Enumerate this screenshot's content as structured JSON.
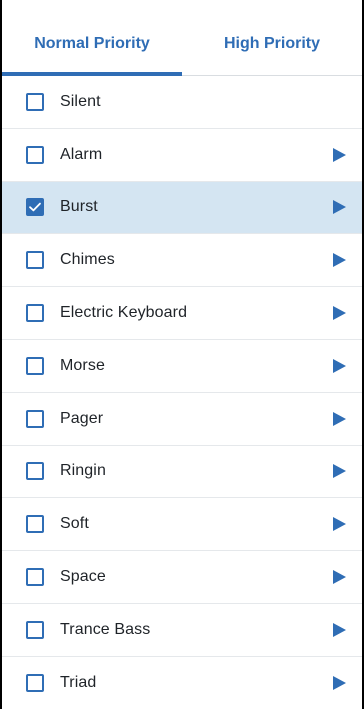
{
  "tabs": [
    {
      "label": "Normal Priority",
      "active": true
    },
    {
      "label": "High Priority",
      "active": false
    }
  ],
  "ringtones": [
    {
      "label": "Silent",
      "checked": false,
      "playable": false
    },
    {
      "label": "Alarm",
      "checked": false,
      "playable": true
    },
    {
      "label": "Burst",
      "checked": true,
      "playable": true
    },
    {
      "label": "Chimes",
      "checked": false,
      "playable": true
    },
    {
      "label": "Electric Keyboard",
      "checked": false,
      "playable": true
    },
    {
      "label": "Morse",
      "checked": false,
      "playable": true
    },
    {
      "label": "Pager",
      "checked": false,
      "playable": true
    },
    {
      "label": "Ringin",
      "checked": false,
      "playable": true
    },
    {
      "label": "Soft",
      "checked": false,
      "playable": true
    },
    {
      "label": "Space",
      "checked": false,
      "playable": true
    },
    {
      "label": "Trance Bass",
      "checked": false,
      "playable": true
    },
    {
      "label": "Triad",
      "checked": false,
      "playable": true
    }
  ],
  "icons": {
    "checkbox_checked": "checkbox-checked-icon",
    "checkbox_unchecked": "checkbox-unchecked-icon",
    "play": "play-icon"
  },
  "colors": {
    "accent": "#2f6db5",
    "selected_row_bg": "#d4e5f2",
    "text": "#1f2328",
    "divider": "#e5e8eb"
  }
}
